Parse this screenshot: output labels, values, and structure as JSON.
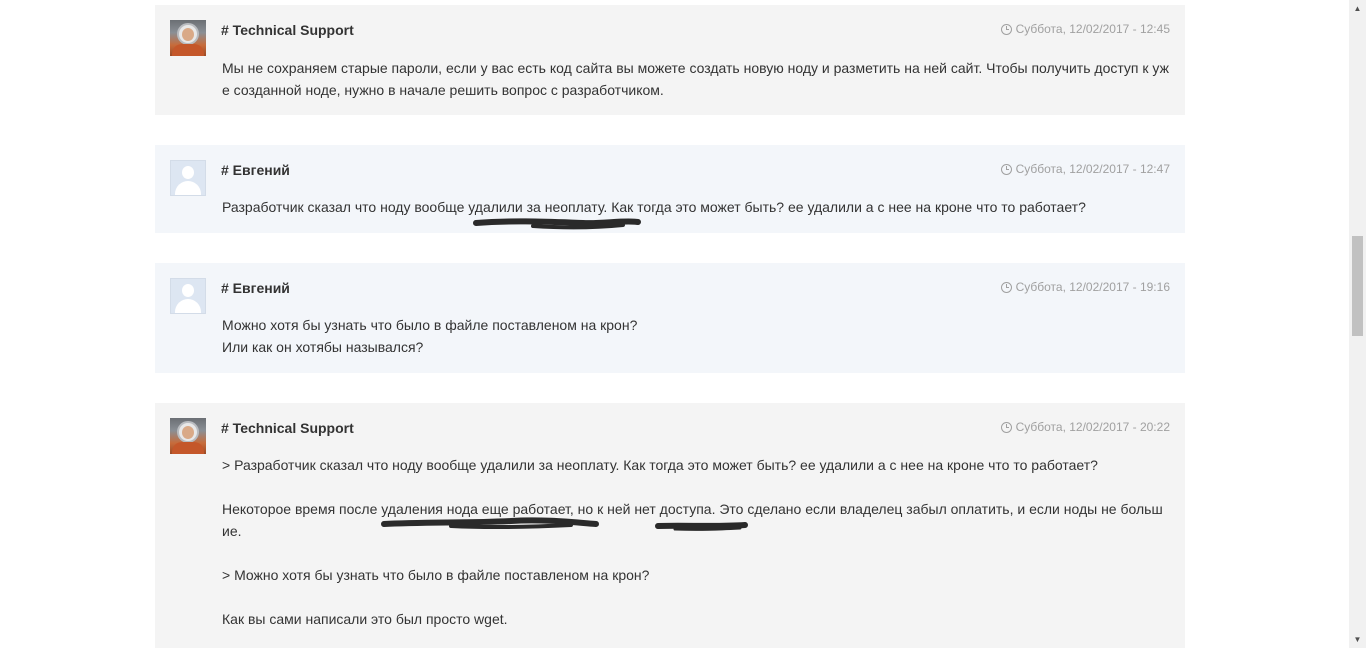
{
  "messages": [
    {
      "author": "# Technical Support",
      "date": "Суббота, 12/02/2017 - 12:45",
      "lines": [
        "Мы не сохраняем старые пароли, если у вас есть код сайта вы можете создать новую ноду и разметить на ней сайт. Чтобы получить доступ к уже созданной ноде, нужно в начале решить вопрос с разработчиком."
      ]
    },
    {
      "author": "# Евгений",
      "date": "Суббота, 12/02/2017 - 12:47",
      "lines": [
        "Разработчик сказал что ноду вообще удалили за неоплату. Как тогда это может быть? ее удалили а с нее на кроне что то работает?"
      ]
    },
    {
      "author": "# Евгений",
      "date": "Суббота, 12/02/2017 - 19:16",
      "lines": [
        "Можно хотя бы узнать что было в файле поставленом на крон?",
        "Или как он хотябы назывался?"
      ]
    },
    {
      "author": "# Technical Support",
      "date": "Суббота, 12/02/2017 - 20:22",
      "lines": [
        "> Разработчик сказал что ноду вообще удалили за неоплату. Как тогда это может быть? ее удалили а с нее на кроне что то работает?",
        "Некоторое время после удаления нода еще работает, но к ней нет доступа. Это сделано если владелец забыл оплатить, и если ноды не большие.",
        "> Можно хотя бы узнать что было в файле поставленом на крон?",
        "Как вы сами написали это был просто wget."
      ]
    }
  ],
  "icons": {
    "date": "clock-icon",
    "staff_avatar": "astronaut-avatar",
    "user_avatar": "default-user-avatar",
    "scroll_up": "scroll-up-arrow-icon",
    "scroll_down": "scroll-down-arrow-icon"
  },
  "colors": {
    "staff_bg": "#f4f4f4",
    "client_bg": "#f3f6fa",
    "date_text": "#a0a0a0",
    "scribble": "#2a2a2a"
  }
}
